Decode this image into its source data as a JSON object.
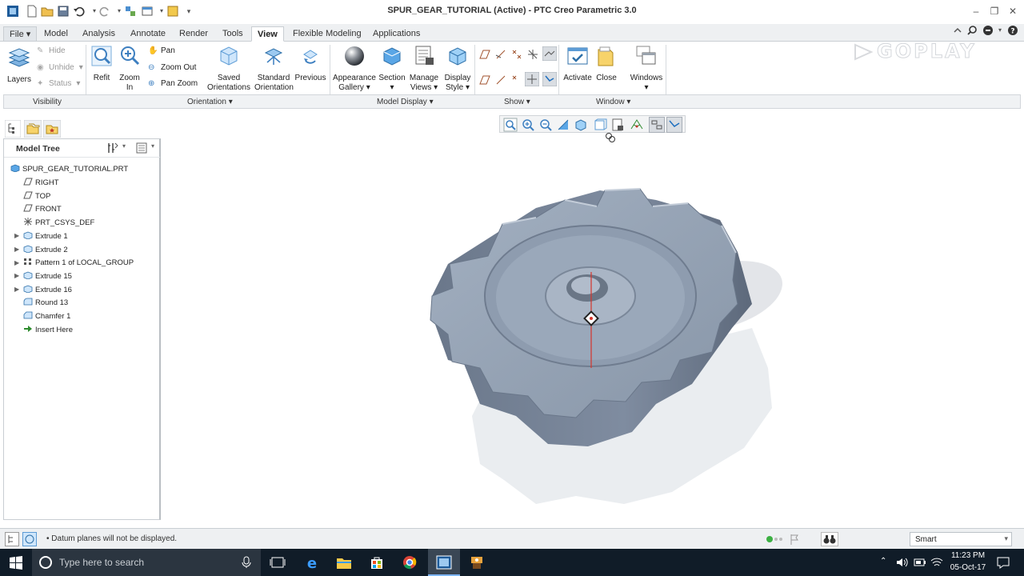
{
  "app": {
    "title": "SPUR_GEAR_TUTORIAL (Active) - PTC Creo Parametric 3.0",
    "watermark": "GOPLAY"
  },
  "tabs": [
    {
      "label": "File ▾"
    },
    {
      "label": "Model"
    },
    {
      "label": "Analysis"
    },
    {
      "label": "Annotate"
    },
    {
      "label": "Render"
    },
    {
      "label": "Tools"
    },
    {
      "label": "View"
    },
    {
      "label": "Flexible Modeling"
    },
    {
      "label": "Applications"
    }
  ],
  "ribbon": {
    "layers": "Layers",
    "hide": "Hide",
    "unhide": "Unhide",
    "status": "Status",
    "refit": "Refit",
    "zoom_in": "Zoom In",
    "pan": "Pan",
    "zoom_out": "Zoom Out",
    "pan_zoom": "Pan Zoom",
    "saved_orientations_1": "Saved",
    "saved_orientations_2": "Orientations ▾",
    "standard_orientation_1": "Standard",
    "standard_orientation_2": "Orientation",
    "previous": "Previous",
    "appearance_1": "Appearance",
    "appearance_2": "Gallery ▾",
    "section_1": "Section",
    "section_2": "▾",
    "manage_views_1": "Manage",
    "manage_views_2": "Views ▾",
    "display_style_1": "Display",
    "display_style_2": "Style ▾",
    "activate": "Activate",
    "close": "Close",
    "windows_1": "Windows",
    "windows_2": "▾"
  },
  "groups": {
    "visibility": "Visibility",
    "orientation": "Orientation ▾",
    "model_display": "Model Display ▾",
    "show": "Show ▾",
    "window": "Window ▾"
  },
  "tree": {
    "title": "Model Tree",
    "items": [
      {
        "label": "SPUR_GEAR_TUTORIAL.PRT"
      },
      {
        "label": "RIGHT"
      },
      {
        "label": "TOP"
      },
      {
        "label": "FRONT"
      },
      {
        "label": "PRT_CSYS_DEF"
      },
      {
        "label": "Extrude 1"
      },
      {
        "label": "Extrude 2"
      },
      {
        "label": "Pattern 1 of LOCAL_GROUP"
      },
      {
        "label": "Extrude 15"
      },
      {
        "label": "Extrude 16"
      },
      {
        "label": "Round 13"
      },
      {
        "label": "Chamfer 1"
      },
      {
        "label": "Insert Here"
      }
    ]
  },
  "status": {
    "message": "• Datum planes will not be displayed.",
    "filter": "Smart"
  },
  "taskbar": {
    "search_placeholder": "Type here to search",
    "time": "11:23 PM",
    "date": "05-Oct-17"
  },
  "colors": {
    "accent": "#1e6fbf",
    "gear": "#8a97a8",
    "taskbar": "#101c28"
  }
}
